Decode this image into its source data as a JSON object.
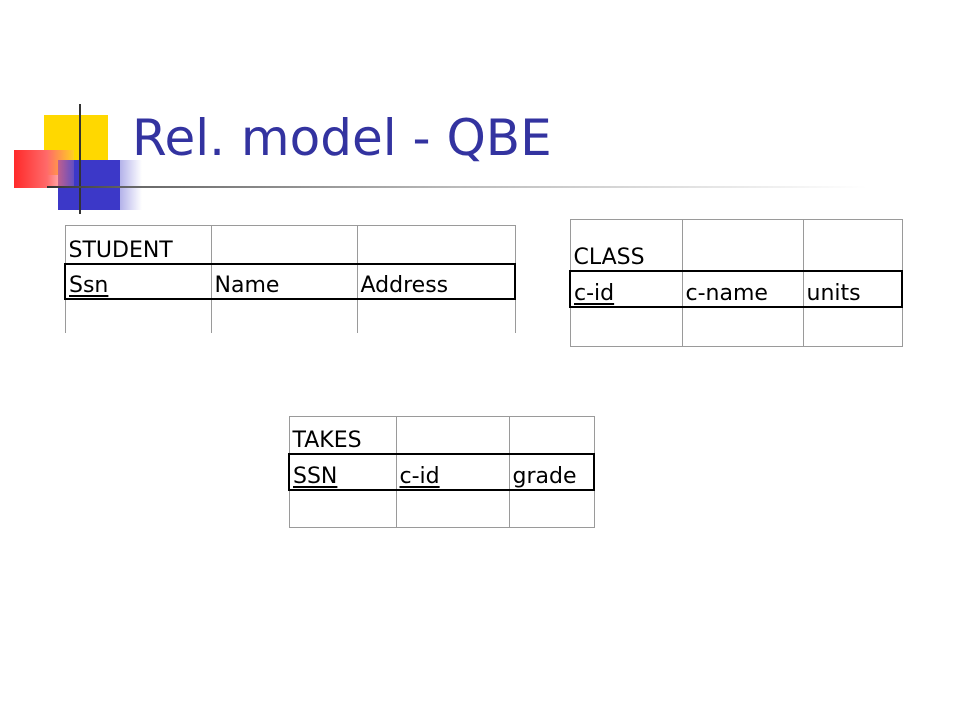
{
  "slide": {
    "title": "Rel. model - QBE"
  },
  "tables": {
    "student": {
      "name": "STUDENT",
      "columns": [
        "Ssn",
        "Name",
        "Address"
      ],
      "key_columns": [
        "Ssn"
      ]
    },
    "class": {
      "name": "CLASS",
      "columns": [
        "c-id",
        "c-name",
        "units"
      ],
      "key_columns": [
        "c-id"
      ]
    },
    "takes": {
      "name": "TAKES",
      "columns": [
        "SSN",
        "c-id",
        "grade"
      ],
      "key_columns": [
        "SSN",
        "c-id"
      ]
    }
  },
  "colors": {
    "title": "#3333a0",
    "accent_yellow": "#ffd800",
    "accent_blue": "#3c38c8",
    "accent_red": "#ff2a2a"
  }
}
